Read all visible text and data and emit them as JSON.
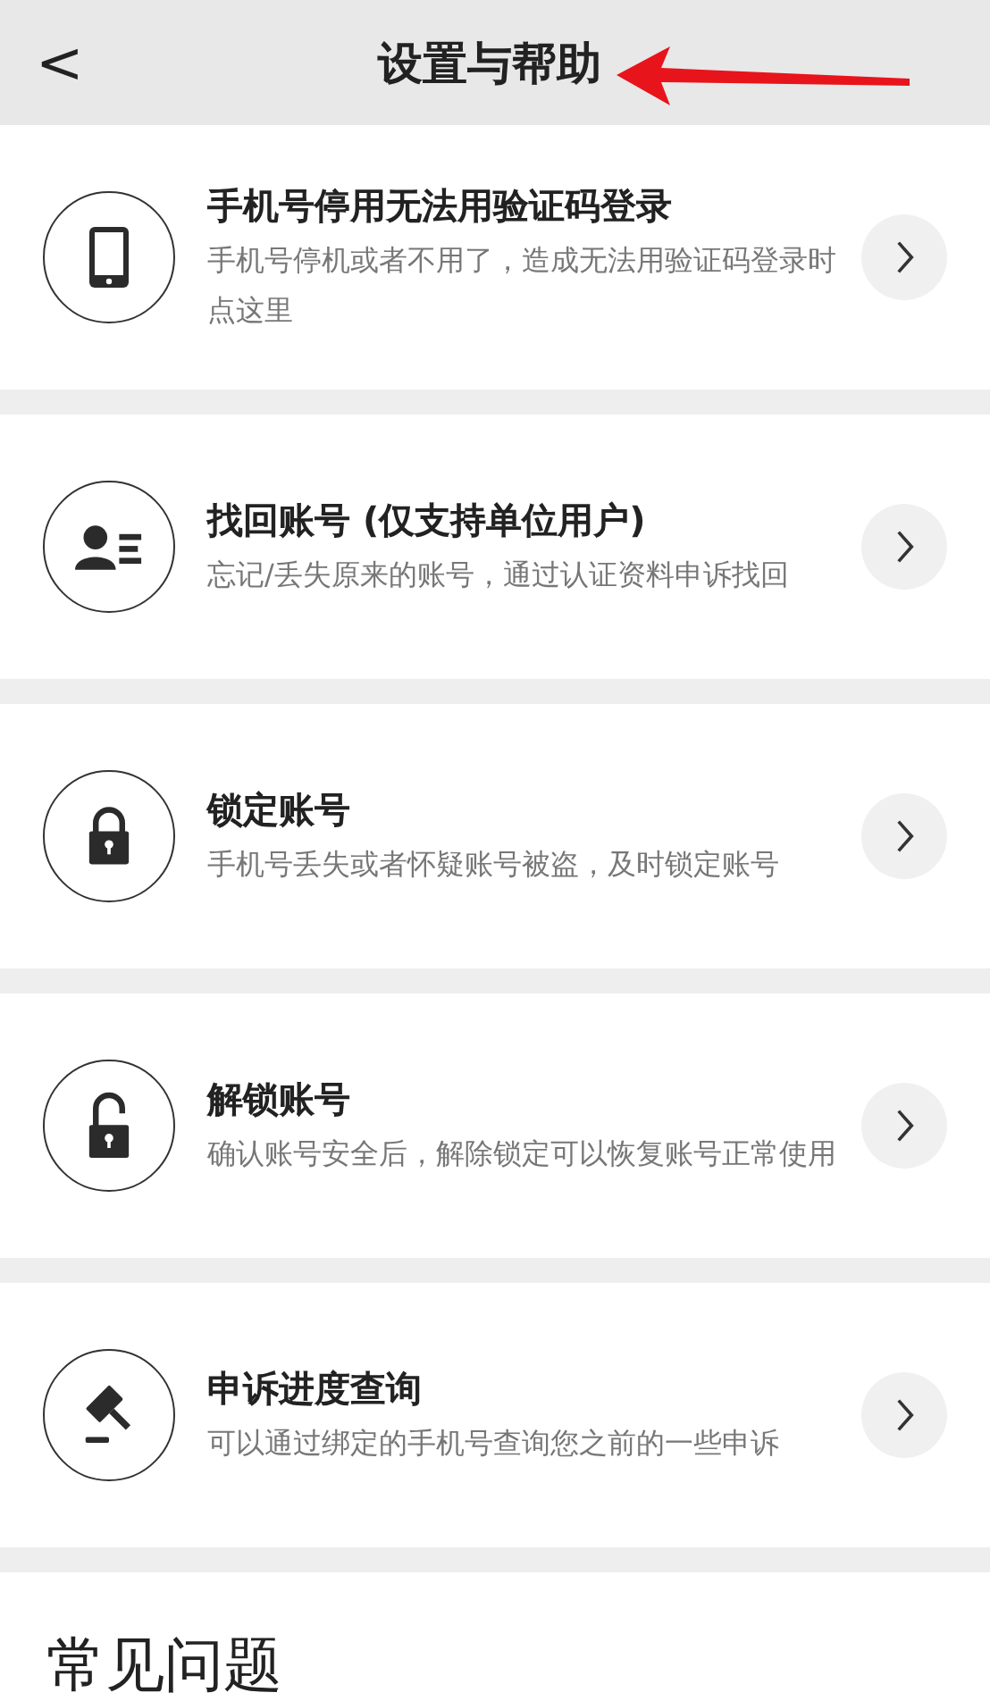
{
  "header": {
    "back": "<",
    "title": "设置与帮助"
  },
  "annotations": [
    {
      "kind": "arrow"
    }
  ],
  "items": [
    {
      "kind": "phone",
      "title": "手机号停用无法用验证码登录",
      "description": "手机号停机或者不用了，造成无法用验证码登录时点这里"
    },
    {
      "kind": "account",
      "title": "找回账号 (仅支持单位用户)",
      "description": "忘记/丢失原来的账号，通过认证资料申诉找回"
    },
    {
      "kind": "lock",
      "title": "锁定账号",
      "description": "手机号丢失或者怀疑账号被盗，及时锁定账号"
    },
    {
      "kind": "unlock",
      "title": "解锁账号",
      "description": "确认账号安全后，解除锁定可以恢复账号正常使用"
    },
    {
      "kind": "appeal",
      "title": "申诉进度查询",
      "description": "可以通过绑定的手机号查询您之前的一些申诉"
    }
  ],
  "section_title": "常见问题"
}
